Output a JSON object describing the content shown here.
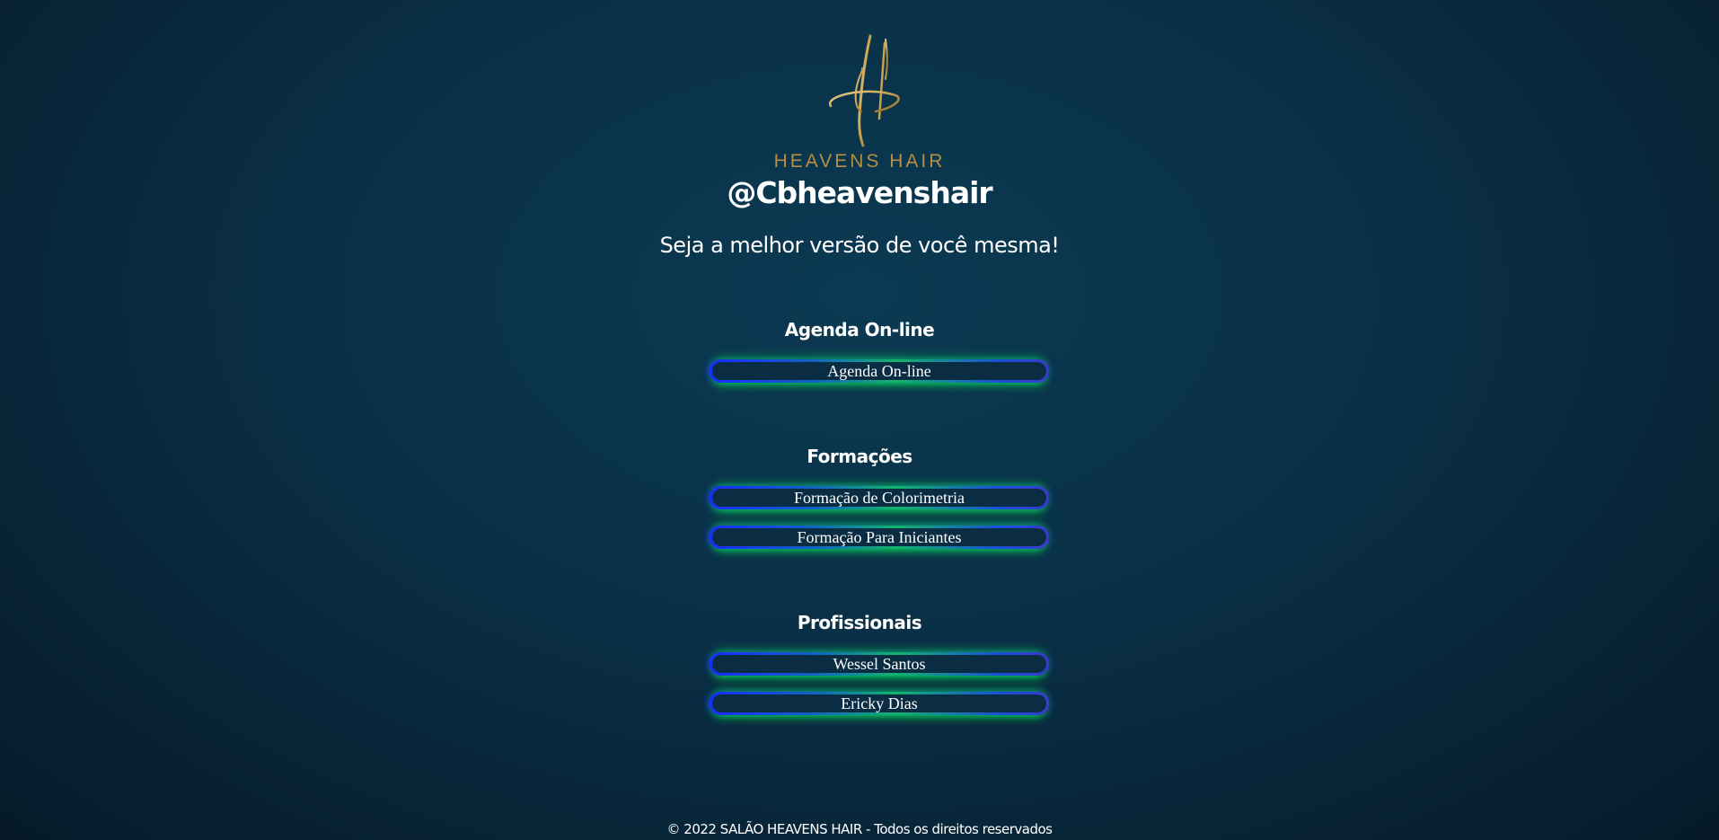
{
  "brand": {
    "logo_icon": "heavens-hair-h-monogram",
    "logo_text": "HEAVENS HAIR",
    "logo_color": "#b58f45"
  },
  "profile": {
    "handle": "@Cbheavenshair",
    "tagline": "Seja a melhor versão de você mesma!"
  },
  "sections": [
    {
      "title": "Agenda On-line",
      "links": [
        "Agenda On-line"
      ]
    },
    {
      "title": "Formações",
      "links": [
        "Formação de Colorimetria",
        "Formação Para Iniciantes"
      ]
    },
    {
      "title": "Profissionais",
      "links": [
        "Wessel Santos",
        "Ericky Dias"
      ]
    }
  ],
  "footer": {
    "text": "© 2022 SALÃO HEAVENS HAIR - Todos os direitos reservados"
  },
  "colors": {
    "background": "#0a3047",
    "glow_green": "#00ff3c",
    "glow_blue": "#1a2cff"
  }
}
